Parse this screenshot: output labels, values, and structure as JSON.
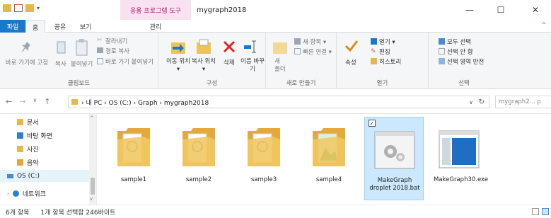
{
  "window": {
    "title": "mygraph2018",
    "context_tab": "응용 프로그램 도구",
    "minimize": "—",
    "maximize": "☐",
    "close": "✕"
  },
  "ribbon_tabs": [
    "파일",
    "홈",
    "공유",
    "보기",
    "관리"
  ],
  "ribbon": {
    "clipboard": {
      "pin_label": "바로 가기에 고정",
      "copy_label": "복사",
      "paste_label": "붙여넣기",
      "cut_label": "잘라내기",
      "copy_path_label": "경로 복사",
      "paste_shortcut_label": "바로 가기 붙여넣기",
      "group_label": "클립보드"
    },
    "organize": {
      "move_to_label": "이동 위치 ▾",
      "copy_to_label": "복사 위치 ▾",
      "delete_label": "삭제",
      "rename_label": "이름 바꾸기",
      "group_label": "구성"
    },
    "new": {
      "new_folder_label": "새 폴더",
      "new_item_label": "새 항목 ▾",
      "easy_access_label": "빠른 연결 ▾",
      "group_label": "새로 만들기"
    },
    "open": {
      "properties_label": "속성",
      "open_label": "열기 ▾",
      "edit_label": "편집",
      "history_label": "히스토리",
      "group_label": "열기"
    },
    "select": {
      "select_all_label": "모두 선택",
      "select_none_label": "선택 안 함",
      "invert_label": "선택 영역 반전",
      "group_label": "선택"
    }
  },
  "address": {
    "path": "› 내 PC › OS (C:) › Graph › mygraph2018",
    "search_placeholder": "mygraph2... ρ"
  },
  "nav": {
    "items": [
      {
        "label": "문서",
        "color": "#e8b64a"
      },
      {
        "label": "바탕 화면",
        "color": "#2f7fd1"
      },
      {
        "label": "사진",
        "color": "#e8b64a"
      },
      {
        "label": "음악",
        "color": "#e8a43a"
      },
      {
        "label": "OS (C:)",
        "color": "#4a8ad4"
      },
      {
        "label": "네트워크",
        "color": "#2f7fd1"
      }
    ]
  },
  "files": [
    {
      "name": "sample1",
      "type": "folder"
    },
    {
      "name": "sample2",
      "type": "folder"
    },
    {
      "name": "sample3",
      "type": "folder"
    },
    {
      "name": "sample4",
      "type": "folder-image"
    },
    {
      "name": "MakeGraph droplet 2018.bat",
      "type": "batch",
      "selected": true
    },
    {
      "name": "MakeGraph30.exe",
      "type": "exe"
    }
  ],
  "status": {
    "count": "6개 항목",
    "selection": "1개 항목 선택함 246바이트"
  },
  "colors": {
    "accent": "#1979ca",
    "context_tab_bg": "#f8e1f1",
    "selection_bg": "#cce8ff"
  }
}
